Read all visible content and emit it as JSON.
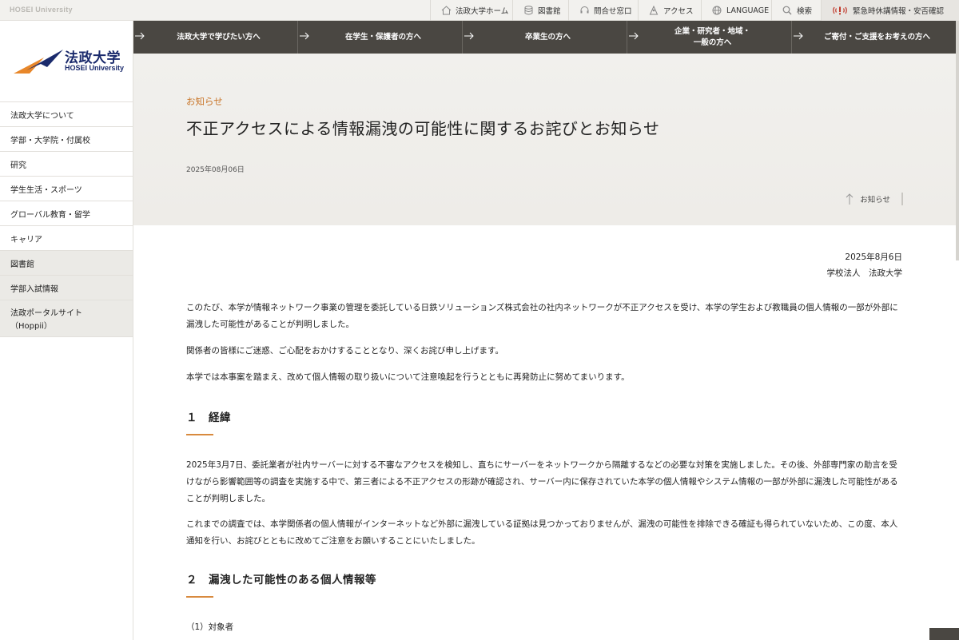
{
  "topbar": {
    "brand": "HOSEI University",
    "links": [
      {
        "label": "法政大学ホーム",
        "icon": "home-icon"
      },
      {
        "label": "図書館",
        "icon": "database-icon"
      },
      {
        "label": "問合せ窓口",
        "icon": "headset-icon"
      },
      {
        "label": "アクセス",
        "icon": "access-icon"
      },
      {
        "label": "LANGUAGE",
        "icon": "globe-icon"
      },
      {
        "label": "検索",
        "icon": "search-icon"
      }
    ],
    "emergency": {
      "label": "緊急時休講情報・安否確認",
      "icon": "alert-icon",
      "accent": "#c0392b"
    }
  },
  "logo": {
    "jp": "法政大学",
    "en": "HOSEI University",
    "navy": "#1a2a6c",
    "orange": "#e8872a"
  },
  "sidebar": {
    "items": [
      {
        "label": "法政大学について"
      },
      {
        "label": "学部・大学院・付属校"
      },
      {
        "label": "研究"
      },
      {
        "label": "学生生活・スポーツ"
      },
      {
        "label": "グローバル教育・留学"
      },
      {
        "label": "キャリア"
      },
      {
        "label": "図書館"
      },
      {
        "label": "学部入試情報"
      },
      {
        "label": "法政ポータルサイト\n（Hoppii）"
      }
    ]
  },
  "audience": [
    {
      "label": "法政大学で学びたい方へ"
    },
    {
      "label": "在学生・保護者の方へ"
    },
    {
      "label": "卒業生の方へ"
    },
    {
      "label": "企業・研究者・地域・\n一般の方へ"
    },
    {
      "label": "ご寄付・ご支援をお考えの方へ"
    }
  ],
  "hero": {
    "category": "お知らせ",
    "title": "不正アクセスによる情報漏洩の可能性に関するお詫びとお知らせ",
    "date": "2025年08月06日",
    "back_label": "お知らせ"
  },
  "article": {
    "sign_date": "2025年8月6日",
    "sign_org": "学校法人　法政大学",
    "intro": [
      "このたび、本学が情報ネットワーク事業の管理を委託している日鉄ソリューションズ株式会社の社内ネットワークが不正アクセスを受け、本学の学生および教職員の個人情報の一部が外部に漏洩した可能性があることが判明しました。",
      "関係者の皆様にご迷惑、ご心配をおかけすることとなり、深くお詫び申し上げます。",
      "本学では本事案を踏まえ、改めて個人情報の取り扱いについて注意喚起を行うとともに再発防止に努めてまいります。"
    ],
    "section1_title": "１　経緯",
    "section1_paras": [
      "2025年3月7日、委託業者が社内サーバーに対する不審なアクセスを検知し、直ちにサーバーをネットワークから隔離するなどの必要な対策を実施しました。その後、外部専門家の助言を受けながら影響範囲等の調査を実施する中で、第三者による不正アクセスの形跡が確認され、サーバー内に保存されていた本学の個人情報やシステム情報の一部が外部に漏洩した可能性があることが判明しました。",
      "これまでの調査では、本学関係者の個人情報がインターネットなど外部に漏洩している証拠は見つかっておりませんが、漏洩の可能性を排除できる確証も得られていないため、この度、本人通知を行い、お詫びとともに改めてご注意をお願いすることにいたしました。"
    ],
    "section2_title": "２　漏洩した可能性のある個人情報等",
    "sub1": "（1）対象者"
  }
}
